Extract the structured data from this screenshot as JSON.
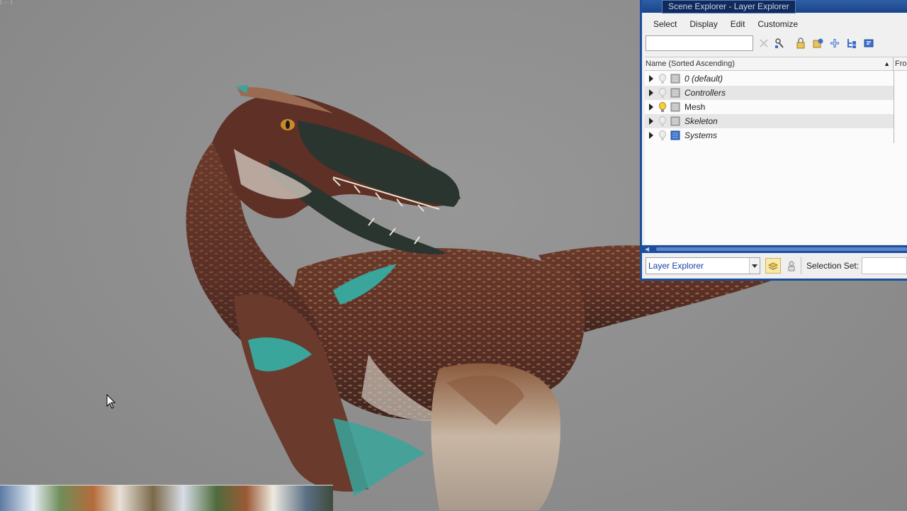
{
  "viewport": {
    "label": "[ ... ]"
  },
  "scene_explorer": {
    "title": "Scene Explorer - Layer Explorer",
    "menu": [
      "Select",
      "Display",
      "Edit",
      "Customize"
    ],
    "search": {
      "value": "",
      "placeholder": ""
    },
    "columns": {
      "name": "Name (Sorted Ascending)",
      "frozen": "Fro"
    },
    "layers": [
      {
        "label": "0 (default)",
        "italic": true,
        "light": "off",
        "icon": "layer-gray"
      },
      {
        "label": "Controllers",
        "italic": true,
        "light": "off",
        "icon": "layer-gray"
      },
      {
        "label": "Mesh",
        "italic": false,
        "light": "on",
        "icon": "layer-gray"
      },
      {
        "label": "Skeleton",
        "italic": true,
        "light": "off",
        "icon": "layer-gray"
      },
      {
        "label": "Systems",
        "italic": true,
        "light": "off",
        "icon": "layer-blue"
      }
    ],
    "explorer_type": "Layer Explorer",
    "selection_set_label": "Selection Set:"
  },
  "colors": {
    "title_bar": "#1b4489",
    "accent_blue": "#1d4e9e",
    "viewport_bg": "#8f8f8f",
    "dino_body": "#5a2f26",
    "dino_beak": "#2a3530",
    "feather_teal": "#3aa59b"
  }
}
